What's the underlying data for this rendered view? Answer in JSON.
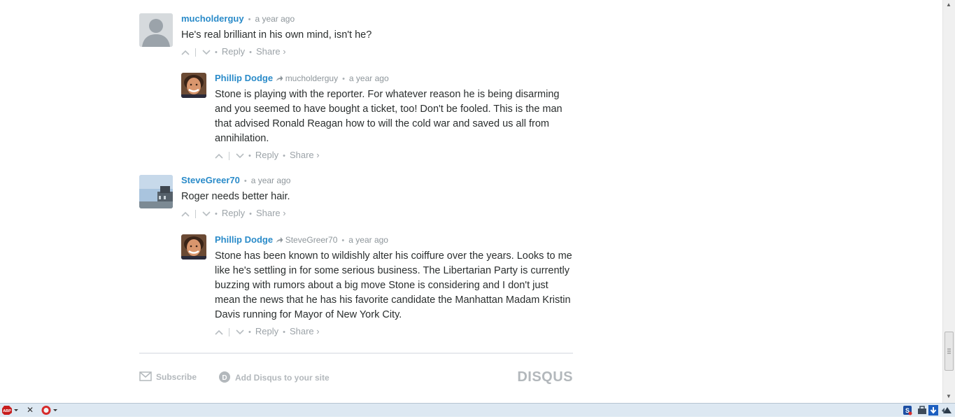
{
  "comments": [
    {
      "author": "mucholderguy",
      "time": "a year ago",
      "text": "He's real brilliant in his own mind, isn't he?",
      "reply_label": "Reply",
      "share_label": "Share ›"
    },
    {
      "author": "Phillip Dodge",
      "reply_to": "mucholderguy",
      "time": "a year ago",
      "text": "Stone is playing with the reporter. For whatever reason he is being disarming and you seemed to have bought a ticket, too! Don't be fooled. This is the man that advised Ronald Reagan how to will the cold war and saved us all from annihilation.",
      "reply_label": "Reply",
      "share_label": "Share ›"
    },
    {
      "author": "SteveGreer70",
      "time": "a year ago",
      "text": "Roger needs better hair.",
      "reply_label": "Reply",
      "share_label": "Share ›"
    },
    {
      "author": "Phillip Dodge",
      "reply_to": "SteveGreer70",
      "time": "a year ago",
      "text": "Stone has been known to wildishly alter his coiffure over the years. Looks to me like he's settling in for some serious business. The Libertarian Party is currently buzzing with rumors about a big move Stone is considering and I don't just mean the news that he has his favorite candidate the Manhattan Madam Kristin Davis running for Mayor of New York City.",
      "reply_label": "Reply",
      "share_label": "Share ›"
    }
  ],
  "footer": {
    "subscribe": "Subscribe",
    "add_disqus": "Add Disqus to your site",
    "logo": "DISQUS"
  },
  "statusbar": {
    "abp_label": "ABP"
  },
  "colors": {
    "author": "#2a8bc9",
    "muted": "#9ca3a8",
    "statusbar": "#dde8f2"
  }
}
